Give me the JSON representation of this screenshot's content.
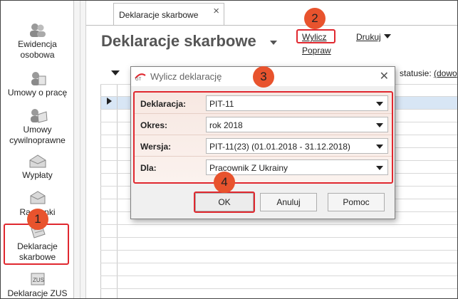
{
  "sidebar": {
    "items": [
      {
        "label_lines": [
          "Ewidencja",
          "osobowa"
        ],
        "icon": "people-icon"
      },
      {
        "label_lines": [
          "Umowy o pracę"
        ],
        "icon": "contract-icon"
      },
      {
        "label_lines": [
          "Umowy",
          "cywilnoprawne"
        ],
        "icon": "civil-contract-icon"
      },
      {
        "label_lines": [
          "Wypłaty"
        ],
        "icon": "payout-envelope-icon"
      },
      {
        "label_lines": [
          "Rachunki"
        ],
        "icon": "bills-icon"
      },
      {
        "label_lines": [
          "Deklaracje",
          "skarbowe"
        ],
        "icon": "tax-declaration-icon"
      },
      {
        "label_lines": [
          "Deklaracje ZUS"
        ],
        "icon": "zus-icon"
      }
    ]
  },
  "tab": {
    "label": "Deklaracje skarbowe",
    "close": "×"
  },
  "header": {
    "title": "Deklaracje skarbowe",
    "actions": {
      "wylicz": "Wylicz",
      "popraw": "Popraw",
      "drukuj": "Drukuj"
    }
  },
  "grid_header": {
    "status_label": "statusie:",
    "status_link": "(dowo"
  },
  "dialog": {
    "title": "Wylicz deklarację",
    "close": "✕",
    "fields": [
      {
        "label": "Deklaracja:",
        "value": "PIT-11"
      },
      {
        "label": "Okres:",
        "value": "rok 2018"
      },
      {
        "label": "Wersja:",
        "value": "PIT-11(23) (01.01.2018 - 31.12.2018)"
      },
      {
        "label": "Dla:",
        "value": "Pracownik Z Ukrainy"
      }
    ],
    "buttons": {
      "ok": "OK",
      "cancel": "Anuluj",
      "help": "Pomoc"
    }
  },
  "annotations": {
    "step1": "1",
    "step2": "2",
    "step3": "3",
    "step4": "4"
  },
  "colors": {
    "highlight": "#e0282f",
    "badge": "#e8532d",
    "selected_row": "#d8e6f5"
  }
}
